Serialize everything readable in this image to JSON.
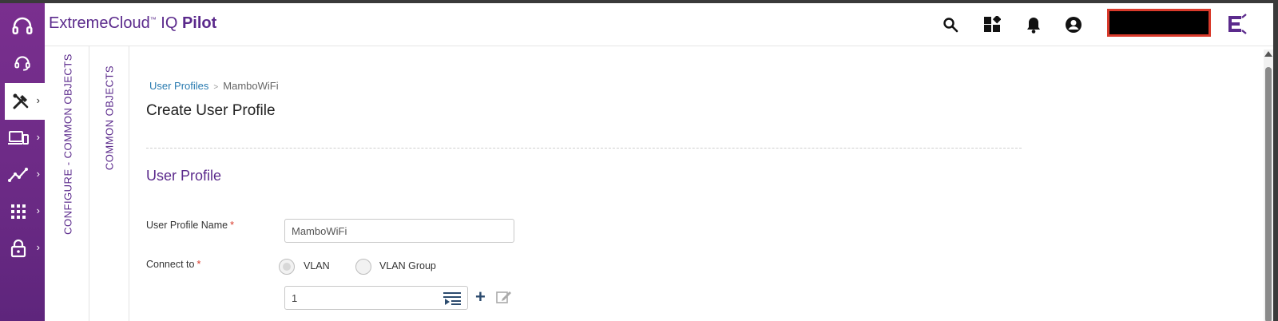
{
  "header": {
    "brand_extreme": "ExtremeCloud",
    "brand_tm": "™",
    "brand_iq": " IQ ",
    "brand_pilot": "Pilot",
    "icons": [
      "search-icon",
      "widgets-icon",
      "bell-icon",
      "account-icon",
      "extreme-logo-icon"
    ]
  },
  "rail": {
    "items": [
      "support-headset-icon",
      "support-headset-icon",
      "tools-icon",
      "devices-icon",
      "analytics-icon",
      "apps-grid-icon",
      "lock-icon"
    ],
    "active_index": 2
  },
  "vertical_tabs": {
    "configure": "CONFIGURE - COMMON OBJECTS",
    "common": "COMMON OBJECTS"
  },
  "breadcrumb": {
    "link": "User Profiles",
    "separator": ">",
    "current": "MamboWiFi"
  },
  "page": {
    "title": "Create User Profile",
    "section": "User Profile"
  },
  "form": {
    "name_label": "User Profile Name",
    "name_value": "MamboWiFi",
    "required_mark": "*",
    "connect_label": "Connect to",
    "radio_vlan": "VLAN",
    "radio_vlan_group": "VLAN Group",
    "selected": "VLAN",
    "vlan_value": "1"
  },
  "colors": {
    "brand_purple": "#5b2a8c",
    "rail_purple": "#6b2a85",
    "link_blue": "#2a7bb0",
    "required_red": "#d93a2b"
  }
}
